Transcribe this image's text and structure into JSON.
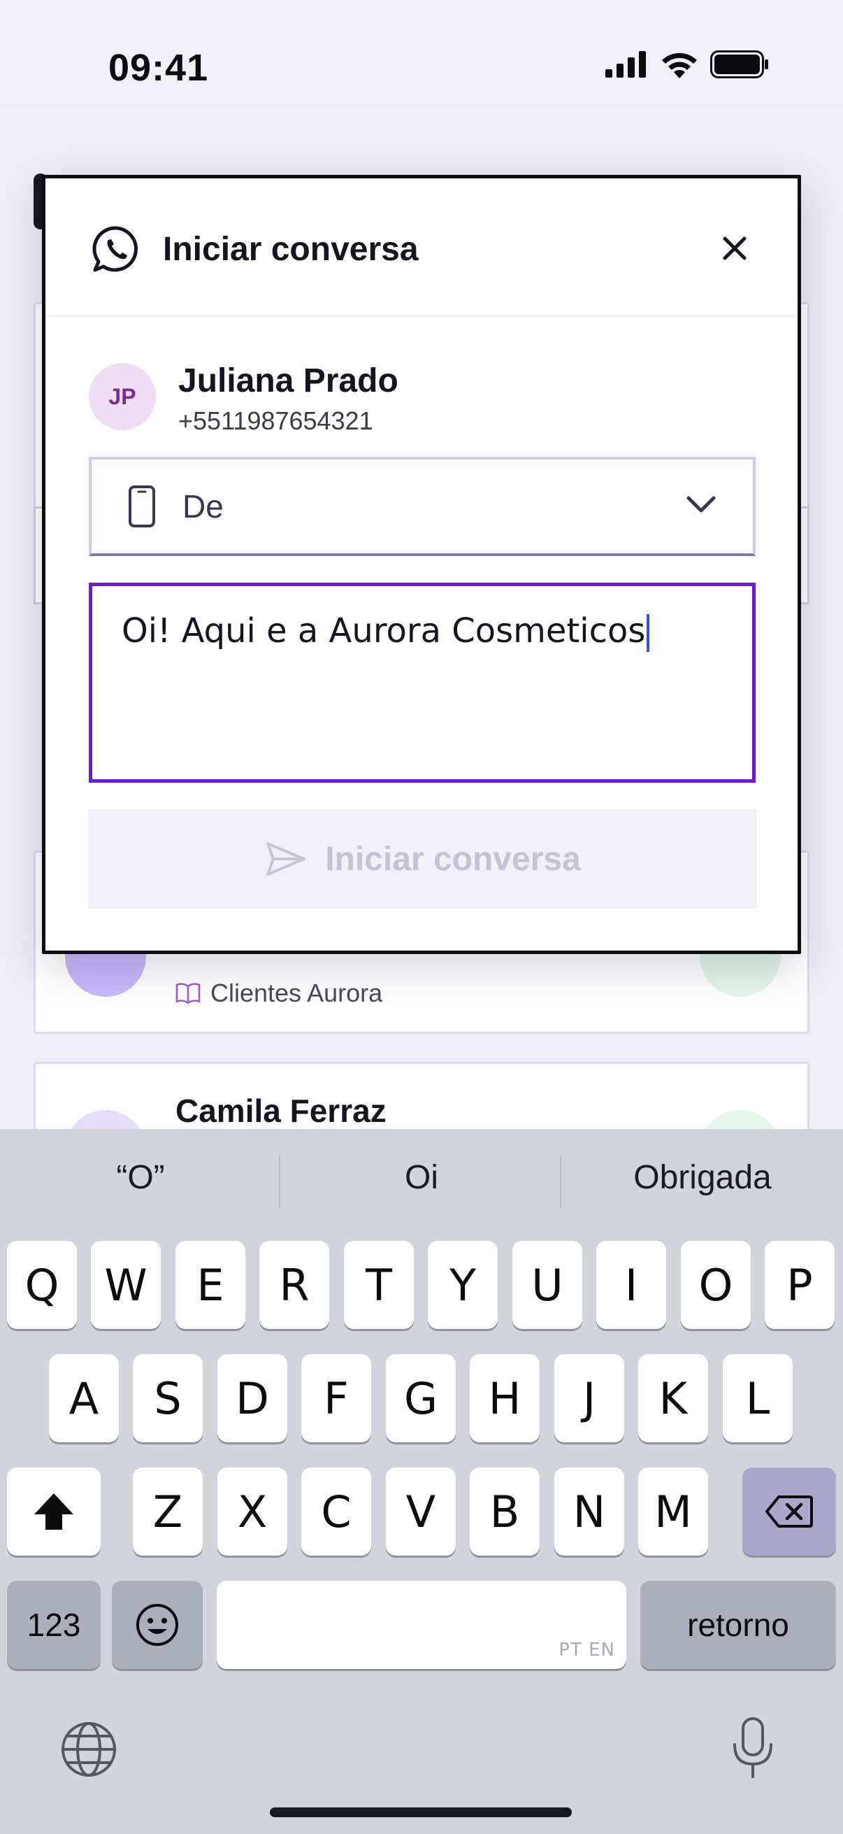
{
  "status_bar": {
    "time": "09:41"
  },
  "background": {
    "cards": [
      {
        "tag": "Clientes Aurora"
      },
      {
        "name": "Camila Ferraz"
      }
    ]
  },
  "modal": {
    "title": "Iniciar conversa",
    "contact": {
      "initials": "JP",
      "name": "Juliana Prado",
      "phone": "+5511987654321"
    },
    "from_select": {
      "label": "De"
    },
    "message": {
      "value": "Oi! Aqui e a Aurora Cosmeticos"
    },
    "start_button": {
      "label": "Iniciar conversa",
      "enabled": false
    }
  },
  "keyboard": {
    "suggestions": [
      "“O”",
      "Oi",
      "Obrigada"
    ],
    "row1": [
      "Q",
      "W",
      "E",
      "R",
      "T",
      "Y",
      "U",
      "I",
      "O",
      "P"
    ],
    "row2": [
      "A",
      "S",
      "D",
      "F",
      "G",
      "H",
      "J",
      "K",
      "L"
    ],
    "row3": [
      "Z",
      "X",
      "C",
      "V",
      "B",
      "N",
      "M"
    ],
    "numbers_label": "123",
    "space_languages": "PT EN",
    "return_label": "retorno"
  },
  "colors": {
    "accent": "#6f1bc7",
    "whatsapp_green": "#25d366",
    "avatar_bg": "#f1dcf6"
  }
}
